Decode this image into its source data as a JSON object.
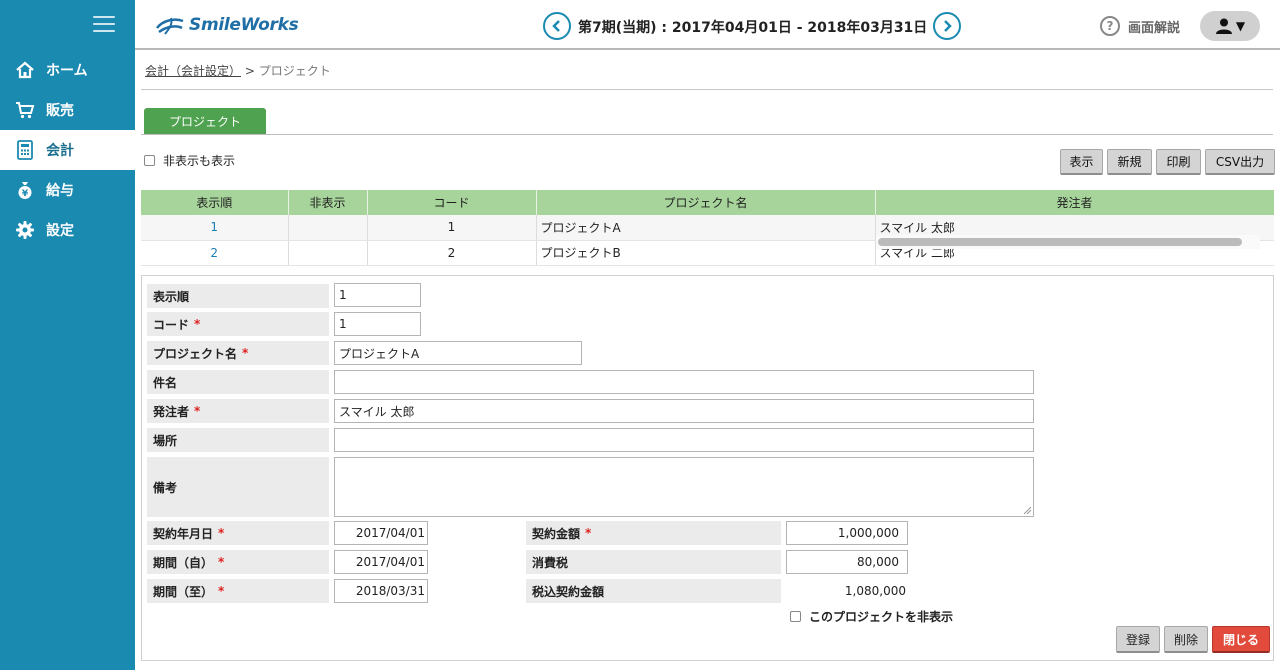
{
  "nav": {
    "items": [
      {
        "label": "ホーム",
        "icon": "home-icon"
      },
      {
        "label": "販売",
        "icon": "cart-icon"
      },
      {
        "label": "会計",
        "icon": "calculator-icon"
      },
      {
        "label": "給与",
        "icon": "money-bag-icon"
      },
      {
        "label": "設定",
        "icon": "gear-icon"
      }
    ],
    "active": "会計"
  },
  "header": {
    "logo": "SmileWorks",
    "period": "第7期(当期) : 2017年04月01日 - 2018年03月31日",
    "help": "画面解説",
    "help_symbol": "?",
    "user_caret": "▼"
  },
  "breadcrumb": {
    "link": "会計（会計設定）",
    "separator": ">",
    "current": "プロジェクト"
  },
  "tab": {
    "label": "プロジェクト"
  },
  "filter": {
    "show_hidden": "非表示も表示"
  },
  "toolbar": {
    "display": "表示",
    "new": "新規",
    "print": "印刷",
    "csv": "CSV出力"
  },
  "grid": {
    "columns": [
      "表示順",
      "非表示",
      "コード",
      "プロジェクト名",
      "発注者"
    ],
    "rows": [
      {
        "order": "1",
        "hidden": "",
        "code": "1",
        "name": "プロジェクトA",
        "client": "スマイル 太郎"
      },
      {
        "order": "2",
        "hidden": "",
        "code": "2",
        "name": "プロジェクトB",
        "client": "スマイル 二郎"
      }
    ]
  },
  "form": {
    "required_mark": "*",
    "display_order": {
      "label": "表示順",
      "value": "1"
    },
    "code": {
      "label": "コード",
      "value": "1"
    },
    "project_name": {
      "label": "プロジェクト名",
      "value": "プロジェクトA"
    },
    "subject": {
      "label": "件名",
      "value": ""
    },
    "client": {
      "label": "発注者",
      "value": "スマイル 太郎"
    },
    "location": {
      "label": "場所",
      "value": ""
    },
    "notes": {
      "label": "備考",
      "value": ""
    },
    "contract_date": {
      "label": "契約年月日",
      "value": "2017/04/01"
    },
    "period_from": {
      "label": "期間（自）",
      "value": "2017/04/01"
    },
    "period_to": {
      "label": "期間（至）",
      "value": "2018/03/31"
    },
    "contract_amount": {
      "label": "契約金額",
      "value": "1,000,000"
    },
    "consumption_tax": {
      "label": "消費税",
      "value": "80,000"
    },
    "total_with_tax": {
      "label": "税込契約金額",
      "value": "1,080,000"
    },
    "hide_project": "このプロジェクトを非表示"
  },
  "actions": {
    "register": "登録",
    "delete": "削除",
    "close": "閉じる"
  },
  "colors": {
    "sidebar": "#1b8ab0",
    "tab": "#4fa24f",
    "grid_header": "#a7d49b",
    "close_button": "#e24a3c",
    "required": "#dd2222"
  }
}
